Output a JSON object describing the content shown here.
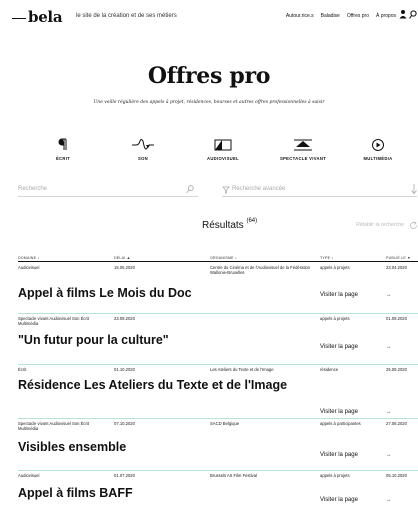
{
  "header": {
    "logo": "bela",
    "tagline": "le site de la création et de ses métiers",
    "nav": [
      "Autour.rice.s",
      "Baladise",
      "Offres pro",
      "À propos"
    ]
  },
  "title": "Offres pro",
  "subtitle": "Une veille régulière des appels à projet, résidences, bourses et autres offres professionnelles à saisir",
  "categories": [
    {
      "label": "ÉCRIT",
      "icon": "pilcrow-icon"
    },
    {
      "label": "SON",
      "icon": "sound-wave-icon"
    },
    {
      "label": "AUDIOVISUEL",
      "icon": "screen-icon"
    },
    {
      "label": "SPECTACLE VIVANT",
      "icon": "stage-icon"
    },
    {
      "label": "MULTIMÉDIA",
      "icon": "play-icon"
    }
  ],
  "search": {
    "placeholder": "Recherche",
    "advanced_placeholder": "Recherche avancée"
  },
  "results": {
    "label": "Résultats",
    "count": "(64)",
    "reset": "Rétablir la recherche"
  },
  "table": {
    "headers": [
      "DOMAINE",
      "DÉLAI",
      "ORGANISME",
      "TYPE",
      "PUBLIÉ LE"
    ],
    "visit_label": "Visiter la page",
    "arrow": "→",
    "rows": [
      {
        "domaine": "Audiovisuel",
        "delai": "15.05.2020",
        "organisme": "Centre du Cinéma et de l'Audiovisuel de la Fédération Wallonie-Bruxelles",
        "type": "appels à projets",
        "publie": "23.04.2020",
        "name": "Appel à films Le Mois du Doc"
      },
      {
        "domaine": "Spectacle vivant Audiovisuel Son Écrit Multimédia",
        "delai": "23.09.2020",
        "organisme": "",
        "type": "appels à projets",
        "publie": "01.09.2020",
        "name": "\"Un futur pour la culture\""
      },
      {
        "domaine": "Écrit",
        "delai": "01.10.2020",
        "organisme": "Les Ateliers du Texte et de l'Image",
        "type": "résidence",
        "publie": "25.09.2020",
        "name": "Résidence Les Ateliers du Texte et de l'Image"
      },
      {
        "domaine": "Spectacle vivant Audiovisuel Son Écrit Multimédia",
        "delai": "07.10.2020",
        "organisme": "SACD Belgique",
        "type": "appels à participantes",
        "publie": "27.08.2020",
        "name": "Visibles ensemble"
      },
      {
        "domaine": "Audiovisuel",
        "delai": "01.07.2020",
        "organisme": "Brussels Art Film Festival",
        "type": "appels à projets",
        "publie": "05.10.2020",
        "name": "Appel à films BAFF"
      }
    ]
  }
}
